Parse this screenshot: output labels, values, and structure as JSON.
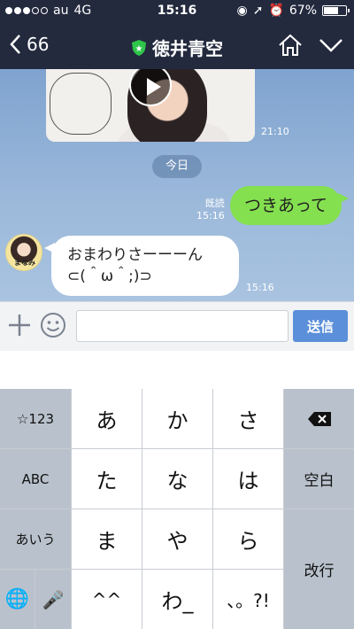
{
  "status_bar": {
    "carrier": "au",
    "network": "4G",
    "time": "15:16",
    "battery": "67%"
  },
  "header": {
    "back_count": "66",
    "title": "徳井青空"
  },
  "chat": {
    "video_time": "21:10",
    "date_separator": "今日",
    "sent_message": {
      "text": "つきあって",
      "read_label": "既読",
      "time": "15:16"
    },
    "received_message": {
      "line1": "おまわりさーーーん",
      "line2": "⊂(＾ω＾;)⊃",
      "time": "15:16",
      "avatar_text": "まなみ"
    }
  },
  "input": {
    "value": "",
    "placeholder": "",
    "send_label": "送信"
  },
  "keyboard": {
    "rows": [
      [
        "☆123",
        "あ",
        "か",
        "さ",
        "⌫"
      ],
      [
        "ABC",
        "た",
        "な",
        "は",
        "空白"
      ],
      [
        "あいう",
        "ま",
        "や",
        "ら",
        "改行"
      ],
      [
        "🌐",
        "🎤",
        "^^",
        "わ_",
        "、。?!"
      ]
    ]
  },
  "colors": {
    "nav": "#232a3e",
    "sent_bubble": "#84e04f",
    "send_button": "#5b8fd9"
  }
}
